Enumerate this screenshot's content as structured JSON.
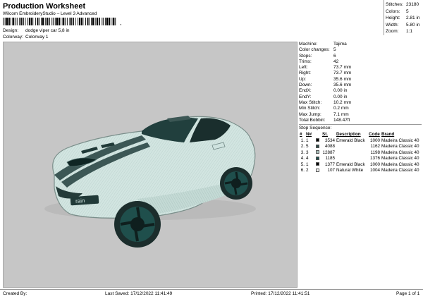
{
  "header": {
    "title": "Production Worksheet",
    "subtitle": "Wilcom EmbroideryStudio – Level 3 Advanced",
    "design_label": "Design:",
    "design_value": "dodge viper car 5,8 in",
    "colorway_label": "Colorway:",
    "colorway_value": "Colorway 1",
    "barcode_tail": ","
  },
  "stats": [
    {
      "label": "Stitches:",
      "value": "23180"
    },
    {
      "label": "Colors:",
      "value": "5"
    },
    {
      "label": "Height:",
      "value": "2.81 in"
    },
    {
      "label": "Width:",
      "value": "5.80 in"
    },
    {
      "label": "Zoom:",
      "value": "1:1"
    }
  ],
  "machine_info": [
    {
      "label": "Machine:",
      "value": "Tajima"
    },
    {
      "label": "Color changes:",
      "value": "5"
    },
    {
      "label": "Stops:",
      "value": "6"
    },
    {
      "label": "Trims:",
      "value": "42"
    },
    {
      "label": "Left:",
      "value": "73.7 mm"
    },
    {
      "label": "Right:",
      "value": "73.7 mm"
    },
    {
      "label": "Up:",
      "value": "35.6 mm"
    },
    {
      "label": "Down:",
      "value": "35.6 mm"
    },
    {
      "label": "EndX:",
      "value": "0.00 in"
    },
    {
      "label": "EndY:",
      "value": "0.00 in"
    },
    {
      "label": "Max Stitch:",
      "value": "10.2 mm"
    },
    {
      "label": "Min Stitch:",
      "value": "0.2 mm"
    },
    {
      "label": "Max Jump:",
      "value": "7.1 mm"
    },
    {
      "label": "Total Bobbin:",
      "value": "148.47ft"
    }
  ],
  "stop_sequence": {
    "title": "Stop Sequence:",
    "headers": {
      "num": "#",
      "n": "N#",
      "st": "St.",
      "desc": "Description",
      "code": "Code",
      "brand": "Brand"
    },
    "rows": [
      {
        "num": "1.",
        "n": "1",
        "color": "#0a0a0a",
        "st": "3534",
        "desc": "Emerald Black",
        "code": "1000",
        "brand": "Madeira Classic 40"
      },
      {
        "num": "2.",
        "n": "5",
        "color": "#2f4a48",
        "st": "4088",
        "desc": "",
        "code": "1162",
        "brand": "Madeira Classic 40"
      },
      {
        "num": "3.",
        "n": "3",
        "color": "#a9c0bb",
        "st": "12887",
        "desc": "",
        "code": "1198",
        "brand": "Madeira Classic 40"
      },
      {
        "num": "4.",
        "n": "4",
        "color": "#1e4d49",
        "st": "1185",
        "desc": "",
        "code": "1376",
        "brand": "Madeira Classic 40"
      },
      {
        "num": "5.",
        "n": "1",
        "color": "#0a0a0a",
        "st": "1377",
        "desc": "Emerald Black",
        "code": "1000",
        "brand": "Madeira Classic 40"
      },
      {
        "num": "6.",
        "n": "2",
        "color": "#f4f4f4",
        "st": "107",
        "desc": "Natural White",
        "code": "1004",
        "brand": "Madeira Classic 40"
      }
    ]
  },
  "footer": {
    "created": "Created By:",
    "saved": "Last Saved: 17/12/2022 11:41:49",
    "printed": "Printed: 17/12/2022 11:41:51",
    "page": "Page 1 of 1"
  },
  "preview": {
    "subject": "embroidered sports car, pale mint-grey body with dark teal racing stripes and teal wheels",
    "background_color": "#c6c6c6",
    "body_color": "#d2e5e1",
    "stripe_color": "#3c5755",
    "wheel_color": "#1f4f4c",
    "plate_text": "rain"
  }
}
